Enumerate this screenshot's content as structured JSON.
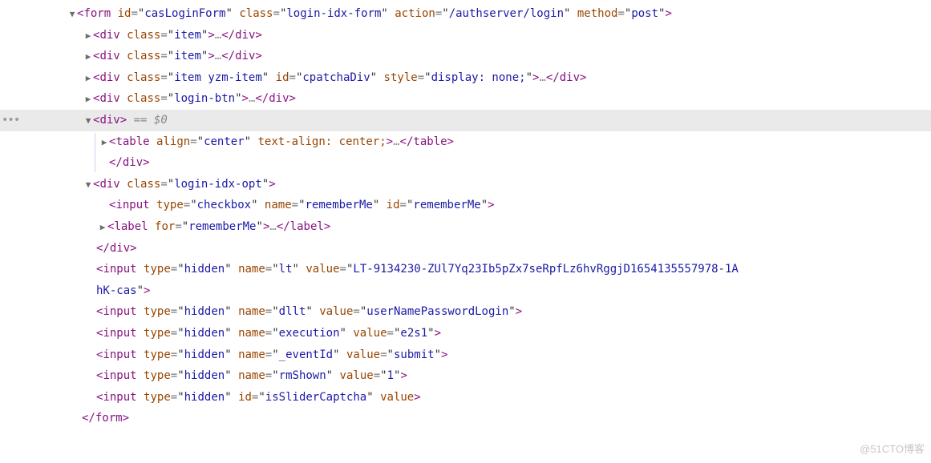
{
  "watermark": "@51CTO博客",
  "gutterDots": "•••",
  "arrows": {
    "down": "▼",
    "right": "▶"
  },
  "ellipsis": "…",
  "selectedMarker": "== $0",
  "lines": {
    "l1": {
      "tag": "form",
      "attrs": [
        {
          "n": "id",
          "v": "casLoginForm"
        },
        {
          "n": "class",
          "v": "login-idx-form"
        },
        {
          "n": "action",
          "v": "/authserver/login"
        },
        {
          "n": "method",
          "v": "post"
        }
      ]
    },
    "l2": {
      "tag": "div",
      "attrs": [
        {
          "n": "class",
          "v": "item"
        }
      ]
    },
    "l3": {
      "tag": "div",
      "attrs": [
        {
          "n": "class",
          "v": "item"
        }
      ]
    },
    "l4": {
      "tag": "div",
      "attrs": [
        {
          "n": "class",
          "v": "item yzm-item"
        },
        {
          "n": "id",
          "v": "cpatchaDiv"
        },
        {
          "n": "style",
          "v": "display: none;"
        }
      ]
    },
    "l5": {
      "tag": "div",
      "attrs": [
        {
          "n": "class",
          "v": "login-btn"
        }
      ]
    },
    "l6": {
      "tag": "div"
    },
    "l7": {
      "tag": "table",
      "attrs": [
        {
          "n": "align",
          "v": "center"
        }
      ],
      "rawtail": " text-align: center;"
    },
    "l7c": "</div>",
    "l8": {
      "tag": "div",
      "attrs": [
        {
          "n": "class",
          "v": "login-idx-opt"
        }
      ]
    },
    "l9": {
      "tag": "input",
      "attrs": [
        {
          "n": "type",
          "v": "checkbox"
        },
        {
          "n": "name",
          "v": "rememberMe"
        },
        {
          "n": "id",
          "v": "rememberMe"
        }
      ]
    },
    "l10": {
      "tag": "label",
      "attrs": [
        {
          "n": "for",
          "v": "rememberMe"
        }
      ]
    },
    "l10c": "</div>",
    "l11_a": "<input type=\"hidden\" name=\"lt\" value=\"LT-9134230-ZUl7Yq23Ib5pZx7seRpfLz6hvRggjD1654135557978-1A",
    "l11_b": "hK-cas\">",
    "l12": {
      "tag": "input",
      "attrs": [
        {
          "n": "type",
          "v": "hidden"
        },
        {
          "n": "name",
          "v": "dllt"
        },
        {
          "n": "value",
          "v": "userNamePasswordLogin"
        }
      ]
    },
    "l13": {
      "tag": "input",
      "attrs": [
        {
          "n": "type",
          "v": "hidden"
        },
        {
          "n": "name",
          "v": "execution"
        },
        {
          "n": "value",
          "v": "e2s1"
        }
      ]
    },
    "l14": {
      "tag": "input",
      "attrs": [
        {
          "n": "type",
          "v": "hidden"
        },
        {
          "n": "name",
          "v": "_eventId"
        },
        {
          "n": "value",
          "v": "submit"
        }
      ]
    },
    "l15": {
      "tag": "input",
      "attrs": [
        {
          "n": "type",
          "v": "hidden"
        },
        {
          "n": "name",
          "v": "rmShown"
        },
        {
          "n": "value",
          "v": "1"
        }
      ]
    },
    "l16": {
      "tag": "input",
      "attrs": [
        {
          "n": "type",
          "v": "hidden"
        },
        {
          "n": "id",
          "v": "isSliderCaptcha"
        }
      ],
      "bareAttr": "value"
    },
    "lend": "</form>"
  }
}
